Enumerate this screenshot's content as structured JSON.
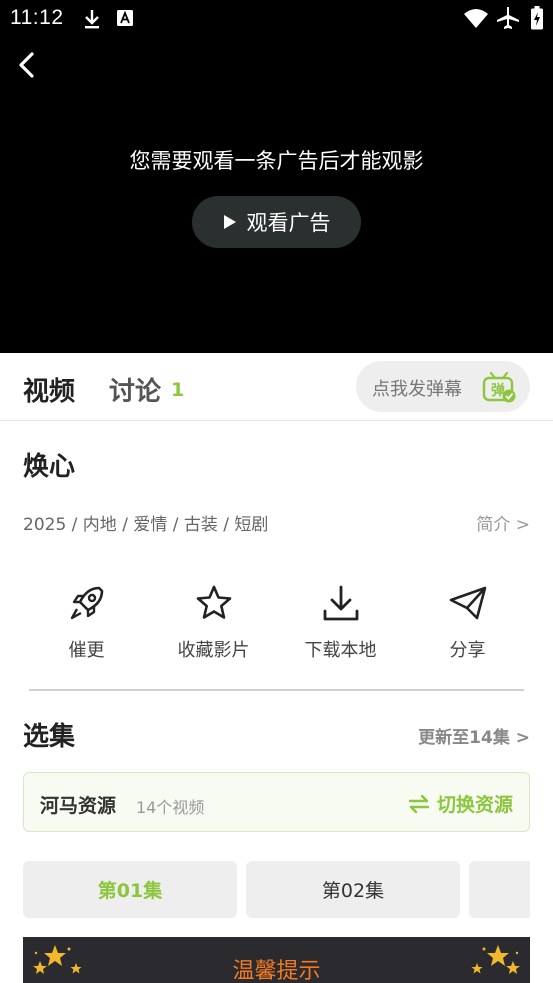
{
  "status": {
    "time": "11:12"
  },
  "player": {
    "ad_message": "您需要观看一条广告后才能观影",
    "ad_button": "观看广告"
  },
  "tabs": {
    "video": "视频",
    "discuss": "讨论",
    "discuss_count": "1",
    "danmaku_button": "点我发弹幕",
    "danmaku_icon_text": "弹"
  },
  "info": {
    "title": "焕心",
    "meta": "2025 / 内地 / 爱情 / 古装 / 短剧",
    "intro_link": "简介 >"
  },
  "actions": [
    {
      "label": "催更",
      "icon": "rocket-icon"
    },
    {
      "label": "收藏影片",
      "icon": "star-icon"
    },
    {
      "label": "下载本地",
      "icon": "download-icon"
    },
    {
      "label": "分享",
      "icon": "share-icon"
    }
  ],
  "episodes": {
    "section_title": "选集",
    "update_link": "更新至14集 >",
    "source_name": "河马资源",
    "source_count": "14个视频",
    "switch_label": "切换资源",
    "items": [
      "第01集",
      "第02集"
    ]
  },
  "tip": {
    "label": "温馨提示"
  },
  "colors": {
    "accent": "#8cc63f",
    "tip_text": "#f37a1f",
    "player_bg": "#000000"
  }
}
